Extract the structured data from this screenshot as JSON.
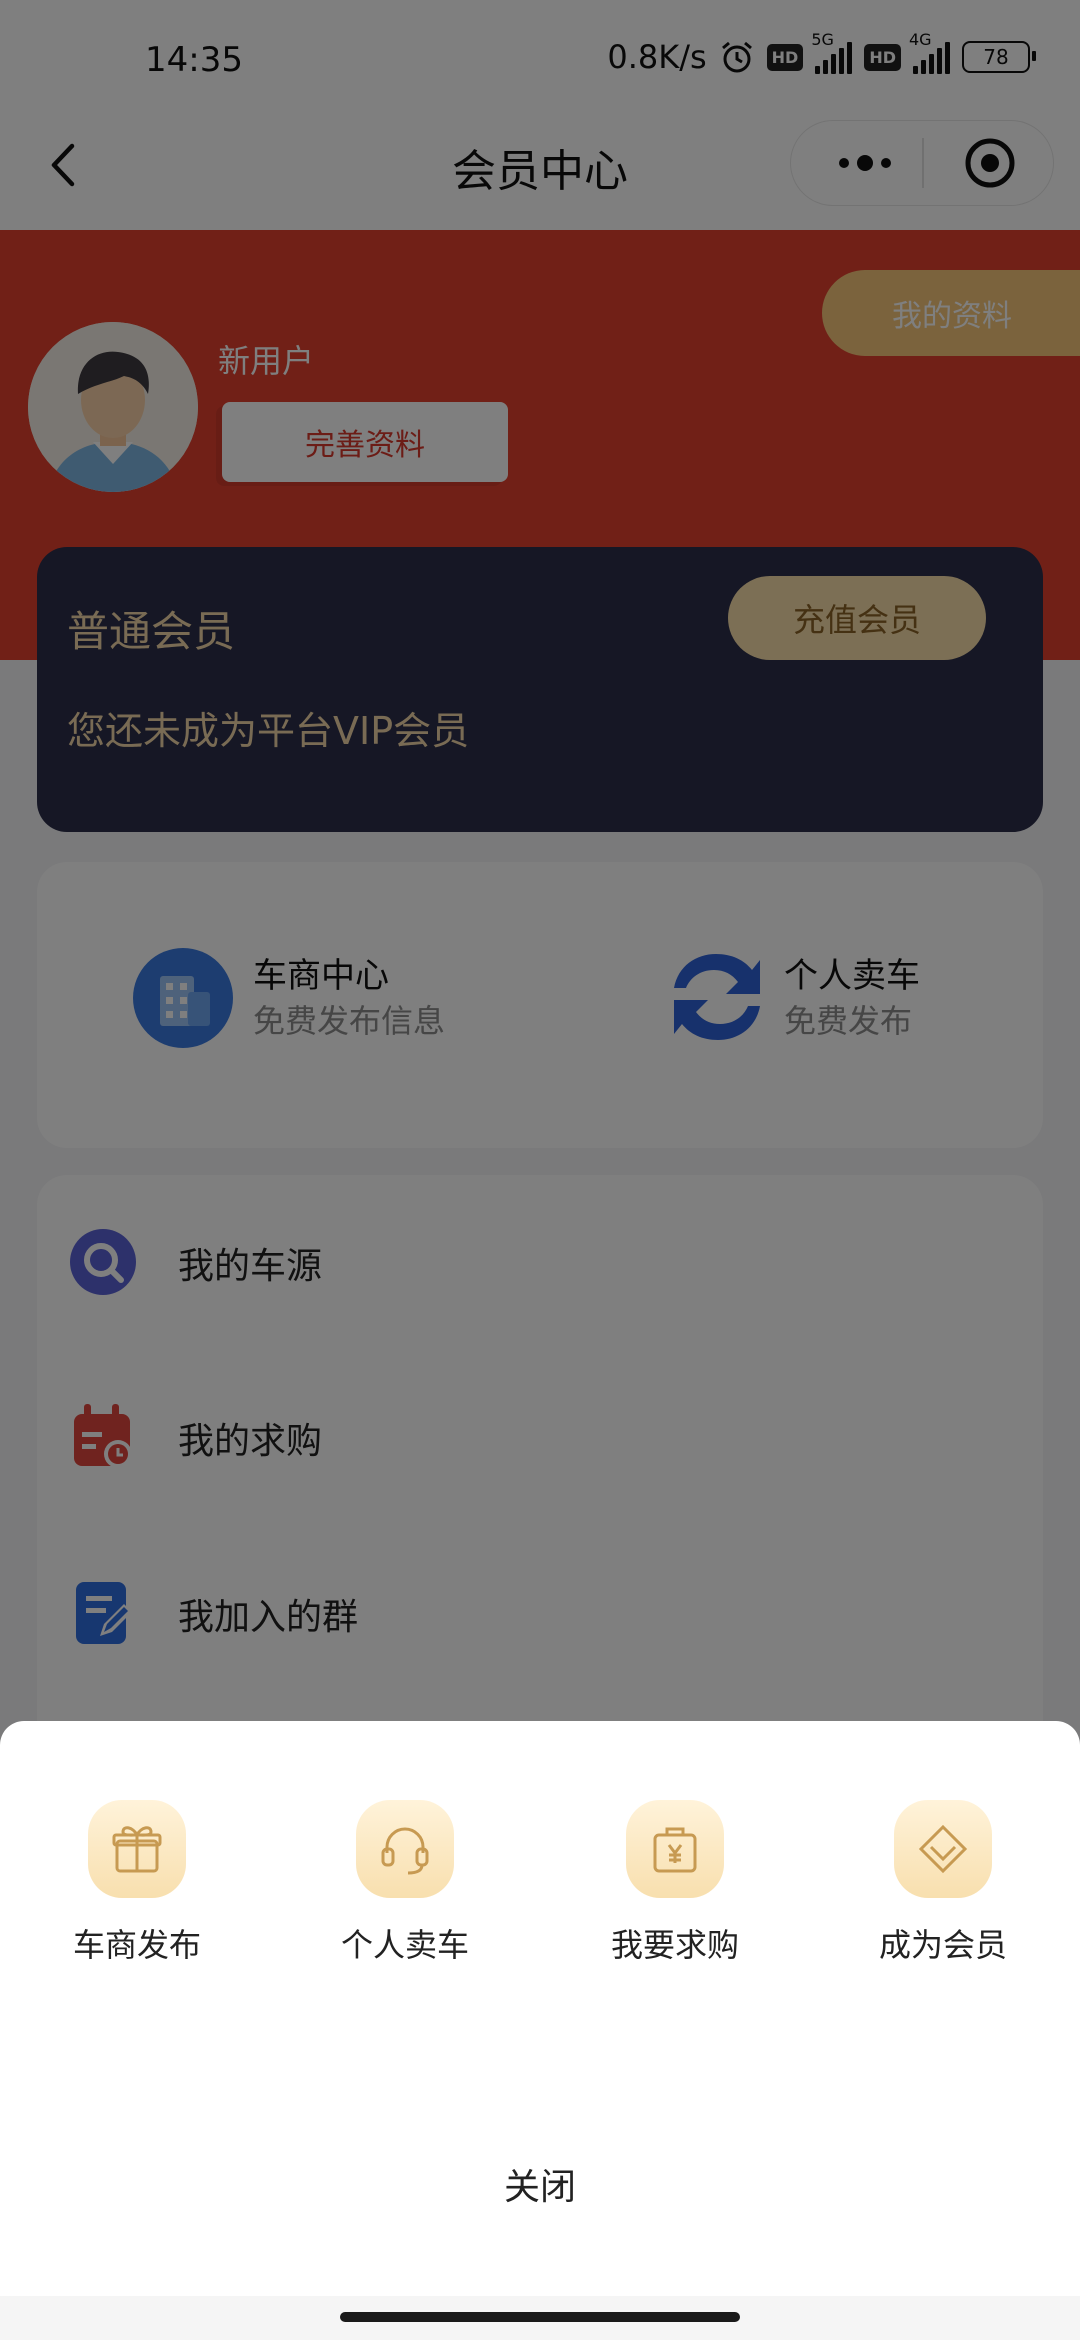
{
  "status_bar": {
    "time": "14:35",
    "speed": "0.8K/s",
    "hd": "HD",
    "net1": "5G",
    "net2": "4G",
    "battery": "78"
  },
  "nav": {
    "title": "会员中心"
  },
  "profile": {
    "username": "新用户",
    "complete_label": "完善资料",
    "my_profile_label": "我的资料"
  },
  "vip": {
    "title": "普通会员",
    "subtitle": "您还未成为平台VIP会员",
    "recharge_label": "充值会员"
  },
  "quick_items": [
    {
      "title": "车商中心",
      "subtitle": "免费发布信息",
      "icon": "building-icon"
    },
    {
      "title": "个人卖车",
      "subtitle": "免费发布",
      "icon": "refresh-arrows-icon"
    }
  ],
  "menu": [
    {
      "label": "我的车源",
      "icon": "search-icon"
    },
    {
      "label": "我的求购",
      "icon": "calendar-icon"
    },
    {
      "label": "我加入的群",
      "icon": "edit-document-icon"
    }
  ],
  "sheet": {
    "items": [
      {
        "label": "车商发布",
        "icon": "gift-icon"
      },
      {
        "label": "个人卖车",
        "icon": "headset-icon"
      },
      {
        "label": "我要求购",
        "icon": "yen-bag-icon"
      },
      {
        "label": "成为会员",
        "icon": "diamond-icon"
      }
    ],
    "close_label": "关闭"
  },
  "colors": {
    "brand_red": "#e2412f",
    "vip_card": "#2c2e4a",
    "gold": "#f2d7a8"
  }
}
